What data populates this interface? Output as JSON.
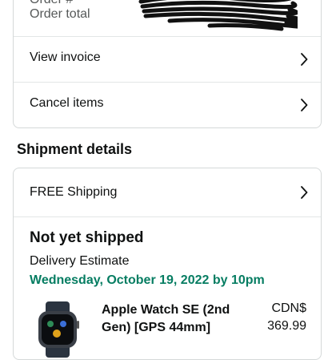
{
  "order_summary": {
    "order_number_label": "Order #",
    "order_total_label": "Order total",
    "view_invoice": "View invoice",
    "cancel_items": "Cancel items"
  },
  "shipment": {
    "section_title": "Shipment details",
    "shipping_method": "FREE Shipping",
    "status": "Not yet shipped",
    "delivery_label": "Delivery Estimate",
    "delivery_date": "Wednesday, October 19, 2022 by 10pm",
    "item": {
      "name": "Apple Watch SE (2nd Gen) [GPS 44mm]",
      "currency": "CDN$",
      "price": "369.99"
    }
  },
  "colors": {
    "delivery_green": "#067d62",
    "border": "#d5d9d9",
    "muted_text": "#565959"
  }
}
